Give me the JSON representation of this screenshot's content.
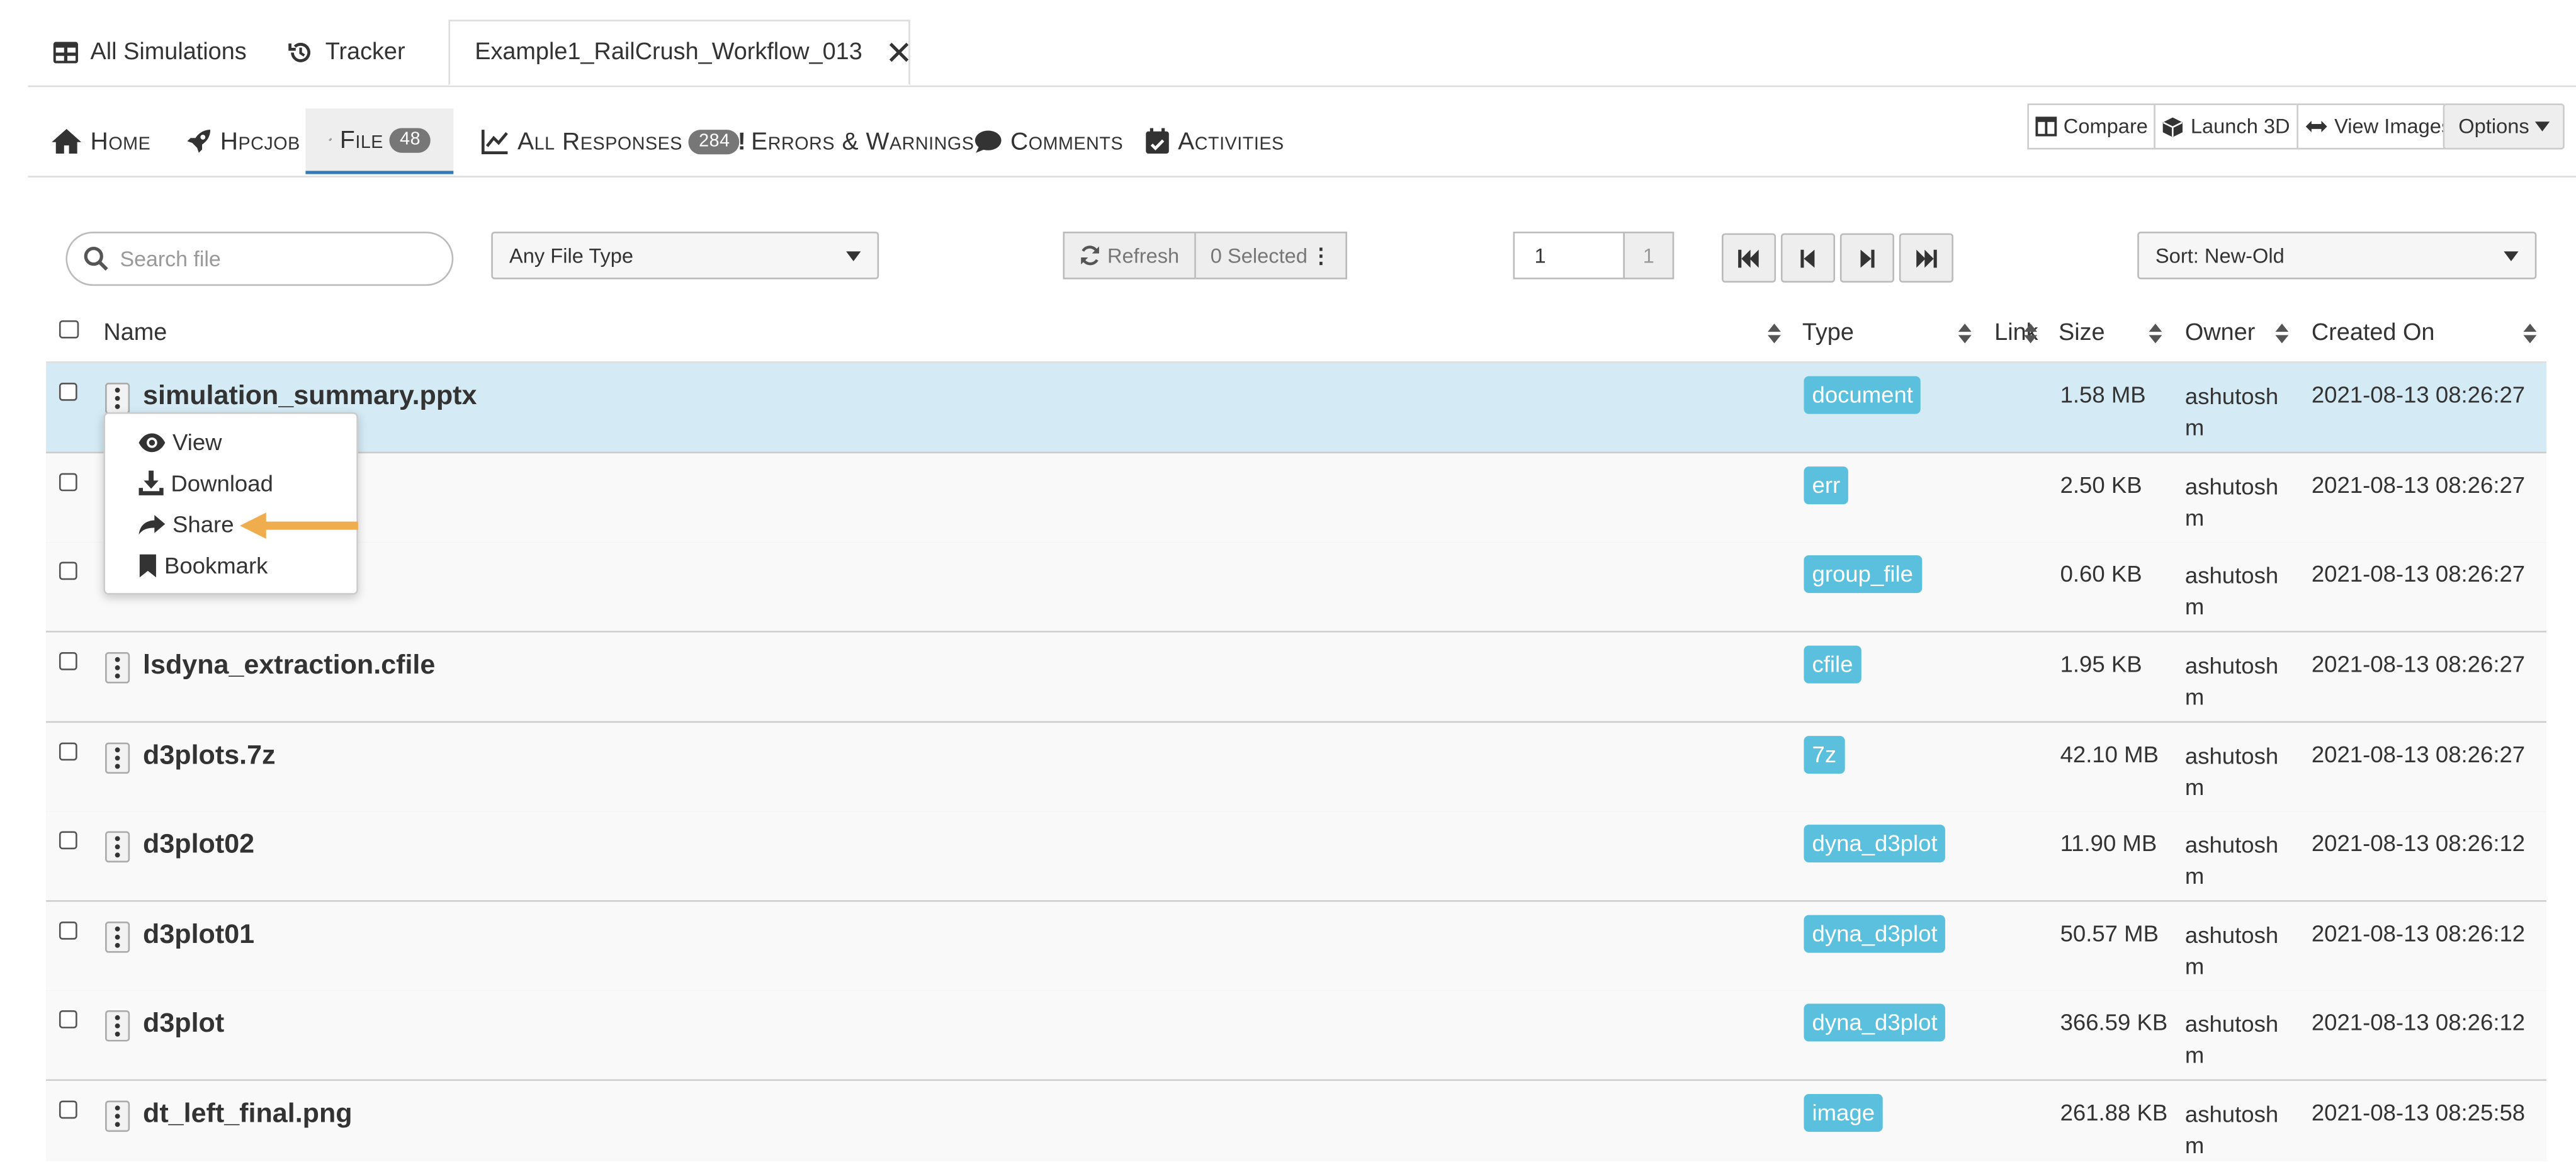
{
  "top_tabs": [
    {
      "label": "All Simulations",
      "icon": "table-icon"
    },
    {
      "label": "Tracker",
      "icon": "history-icon"
    },
    {
      "label": "Example1_RailCrush_Workflow_013",
      "icon": "close-icon",
      "active": true
    }
  ],
  "nav": {
    "home": "Home",
    "hpcjob": "Hpcjob",
    "file": "File",
    "file_count": "48",
    "all_responses": "All Responses",
    "responses_count": "284",
    "errors": "Errors & Warnings",
    "comments": "Comments",
    "activities": "Activities"
  },
  "actions": {
    "compare": "Compare",
    "launch3d": "Launch 3D",
    "view_images": "View Images",
    "options": "Options"
  },
  "toolbar": {
    "search_placeholder": "Search file",
    "file_type": "Any File Type",
    "refresh": "Refresh",
    "selected": "0 Selected",
    "page": "1",
    "page_total": "1",
    "sort": "Sort: New-Old"
  },
  "columns": {
    "name": "Name",
    "type": "Type",
    "link": "Link",
    "size": "Size",
    "owner": "Owner",
    "created": "Created On"
  },
  "rows": [
    {
      "name": "simulation_summary.pptx",
      "type": "document",
      "size": "1.58 MB",
      "owner": "ashutosh m",
      "created": "2021-08-13 08:26:27"
    },
    {
      "name": "",
      "type": "err",
      "size": "2.50 KB",
      "owner": "ashutosh m",
      "created": "2021-08-13 08:26:27"
    },
    {
      "name": "",
      "type": "group_file",
      "size": "0.60 KB",
      "owner": "ashutosh m",
      "created": "2021-08-13 08:26:27"
    },
    {
      "name": "lsdyna_extraction.cfile",
      "type": "cfile",
      "size": "1.95 KB",
      "owner": "ashutosh m",
      "created": "2021-08-13 08:26:27"
    },
    {
      "name": "d3plots.7z",
      "type": "7z",
      "size": "42.10 MB",
      "owner": "ashutosh m",
      "created": "2021-08-13 08:26:27"
    },
    {
      "name": "d3plot02",
      "type": "dyna_d3plot",
      "size": "11.90 MB",
      "owner": "ashutosh m",
      "created": "2021-08-13 08:26:12"
    },
    {
      "name": "d3plot01",
      "type": "dyna_d3plot",
      "size": "50.57 MB",
      "owner": "ashutosh m",
      "created": "2021-08-13 08:26:12"
    },
    {
      "name": "d3plot",
      "type": "dyna_d3plot",
      "size": "366.59 KB",
      "owner": "ashutosh m",
      "created": "2021-08-13 08:26:12"
    },
    {
      "name": "dt_left_final.png",
      "type": "image",
      "size": "261.88 KB",
      "owner": "ashutosh m",
      "created": "2021-08-13 08:25:58"
    }
  ],
  "context_menu": {
    "view": "View",
    "download": "Download",
    "share": "Share",
    "bookmark": "Bookmark"
  },
  "colors": {
    "accent": "#337ab7",
    "badge": "#5bc0de",
    "selected_row": "#d4eaf4",
    "arrow": "#f0ad4e"
  }
}
